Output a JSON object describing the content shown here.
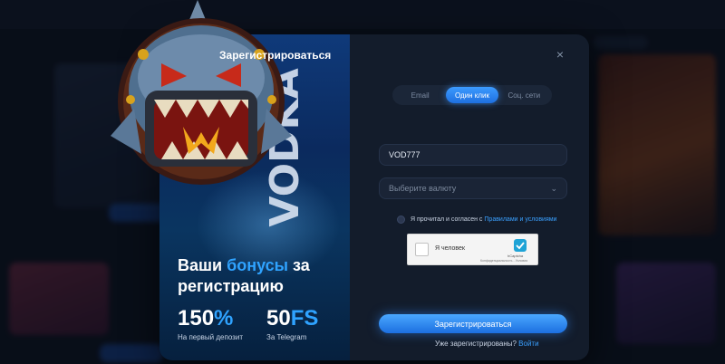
{
  "promo": {
    "brand": "VODKA",
    "title_part1": "Ваши ",
    "title_accent": "бонусы",
    "title_part2": " за регистрацию",
    "stats": [
      {
        "value": "150",
        "unit": "%",
        "label": "На первый депозит"
      },
      {
        "value": "50",
        "unit": "FS",
        "label": "За Telegram"
      }
    ]
  },
  "form": {
    "title": "Зарегистрироваться",
    "close_icon": "×",
    "tabs": [
      {
        "label": "Email",
        "active": false
      },
      {
        "label": "Один клик",
        "active": true
      },
      {
        "label": "Соц. сети",
        "active": false
      }
    ],
    "login_value": "VOD777",
    "currency_placeholder": "Выберите валюту",
    "agree_text": "Я прочитал и согласен с ",
    "agree_link": "Правилами и условиями",
    "captcha": {
      "label": "Я человек",
      "brand": "hCaptcha",
      "terms": "Конфиденциальность - Условия"
    },
    "submit_label": "Зарегистрироваться",
    "already_text": "Уже зарегистрированы? ",
    "login_link": "Войти"
  },
  "colors": {
    "accent": "#2fa3ff",
    "button": "#1c6fe0",
    "panel": "#131c2b"
  }
}
